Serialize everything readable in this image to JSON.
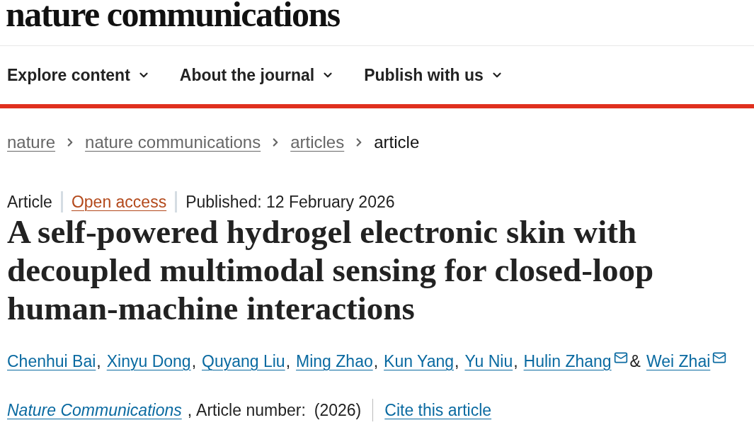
{
  "logo": {
    "text": "nature communications"
  },
  "nav": [
    {
      "label": "Explore content"
    },
    {
      "label": "About the journal"
    },
    {
      "label": "Publish with us"
    }
  ],
  "breadcrumbs": [
    {
      "label": "nature",
      "kind": "link"
    },
    {
      "label": "nature communications",
      "kind": "link"
    },
    {
      "label": "articles",
      "kind": "link"
    },
    {
      "label": "article",
      "kind": "current"
    }
  ],
  "article": {
    "meta": [
      {
        "text": "Article",
        "kind": "type"
      },
      {
        "text": "Open access",
        "kind": "access"
      },
      {
        "text": "Published: 12 February 2026",
        "kind": "date"
      }
    ],
    "title": "A self-powered hydrogel electronic skin with decoupled multimodal sensing for closed-loop human-machine interactions",
    "authors": [
      {
        "name": "Chenhui Bai",
        "email": false,
        "after": ","
      },
      {
        "name": "Xinyu Dong",
        "email": false,
        "after": ","
      },
      {
        "name": "Quyang Liu",
        "email": false,
        "after": ","
      },
      {
        "name": "Ming Zhao",
        "email": false,
        "after": ","
      },
      {
        "name": "Kun Yang",
        "email": false,
        "after": ","
      },
      {
        "name": "Yu Niu",
        "email": false,
        "after": ","
      },
      {
        "name": "Hulin Zhang",
        "email": true,
        "after": "&"
      },
      {
        "name": "Wei Zhai",
        "email": true
      }
    ],
    "citation": {
      "journal": "Nature Communications",
      "separator": ",",
      "article_number_label": "Article number:",
      "year": "(2026)",
      "cite_link": "Cite this article"
    }
  }
}
